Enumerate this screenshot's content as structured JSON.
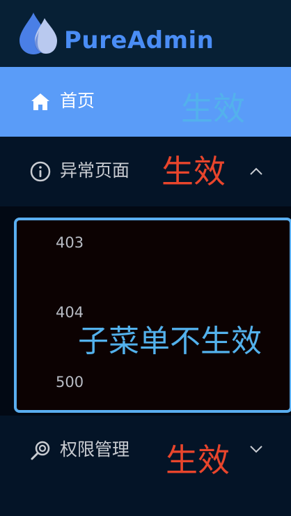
{
  "brand": {
    "title": "PureAdmin",
    "logo_icon": "water-drop-icon",
    "accent_color": "#4a8df5"
  },
  "menu": {
    "home": {
      "label": "首页",
      "icon": "home-icon",
      "active": true
    },
    "error": {
      "label": "异常页面",
      "icon": "info-circle-icon",
      "expanded": true,
      "chevron": "chevron-up-icon"
    },
    "permission": {
      "label": "权限管理",
      "icon": "search-key-icon",
      "expanded": false,
      "chevron": "chevron-down-icon"
    },
    "submenu": [
      {
        "label": "403"
      },
      {
        "label": "404"
      },
      {
        "label": "500"
      }
    ]
  },
  "annotations": {
    "home": "生效",
    "error": "生效",
    "submenu": "子菜单不生效",
    "permission": "生效"
  },
  "colors": {
    "active_bg": "#5a9cf8",
    "sidebar_bg": "#041427",
    "annotation_blue": "#53b1ec",
    "annotation_red": "#e8452c",
    "highlight_border": "#5aaef0"
  }
}
